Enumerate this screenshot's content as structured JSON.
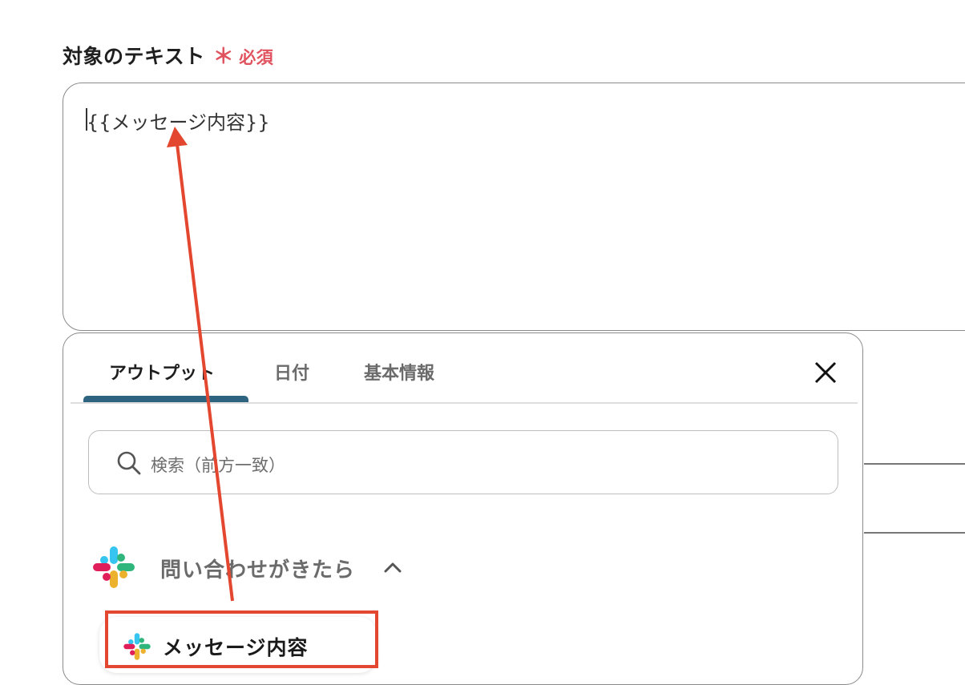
{
  "field": {
    "label": "対象のテキスト",
    "asterisk": "＊",
    "required": "必須",
    "value": "{{メッセージ内容}}"
  },
  "panel": {
    "tabs": [
      {
        "label": "アウトプット",
        "active": true
      },
      {
        "label": "日付",
        "active": false
      },
      {
        "label": "基本情報",
        "active": false
      }
    ],
    "search": {
      "placeholder": "検索（前方一致）"
    },
    "group": {
      "title": "問い合わせがきたら",
      "icon": "slack-icon",
      "expanded": true
    },
    "items": [
      {
        "label": "メッセージ内容",
        "icon": "slack-icon"
      }
    ]
  },
  "colors": {
    "required": "#e0525e",
    "tab_active_underline": "#2f6480",
    "annotation": "#e4472f"
  }
}
